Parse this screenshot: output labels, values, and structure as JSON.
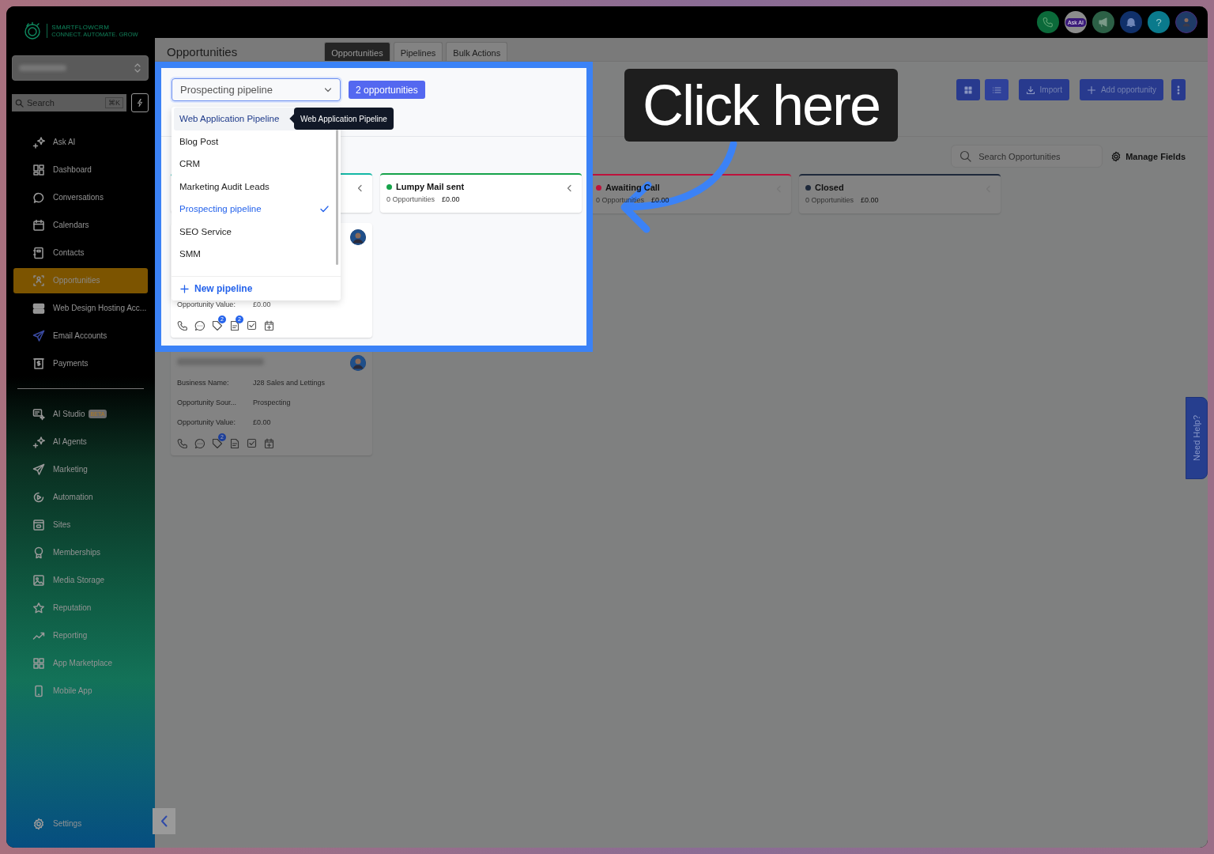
{
  "logo": {
    "name": "SMARTFLOWCRM",
    "tagline": "CONNECT. AUTOMATE. GROW"
  },
  "search": {
    "placeholder": "Search",
    "shortcut": "⌘K"
  },
  "sidebar": {
    "groups": [
      {
        "items": [
          {
            "label": "Ask AI",
            "selected": false
          },
          {
            "label": "Dashboard",
            "selected": false
          },
          {
            "label": "Conversations",
            "selected": false
          },
          {
            "label": "Calendars",
            "selected": false
          },
          {
            "label": "Contacts",
            "selected": false
          },
          {
            "label": "Opportunities",
            "selected": true
          },
          {
            "label": "Web Design Hosting Acc...",
            "selected": false
          },
          {
            "label": "Email Accounts",
            "selected": false
          },
          {
            "label": "Payments",
            "selected": false
          }
        ]
      },
      {
        "items": [
          {
            "label": "AI Studio",
            "selected": false,
            "badge": "BETA"
          },
          {
            "label": "AI Agents",
            "selected": false
          },
          {
            "label": "Marketing",
            "selected": false
          },
          {
            "label": "Automation",
            "selected": false
          },
          {
            "label": "Sites",
            "selected": false
          },
          {
            "label": "Memberships",
            "selected": false
          },
          {
            "label": "Media Storage",
            "selected": false
          },
          {
            "label": "Reputation",
            "selected": false
          },
          {
            "label": "Reporting",
            "selected": false
          },
          {
            "label": "App Marketplace",
            "selected": false
          },
          {
            "label": "Mobile App",
            "selected": false
          }
        ]
      }
    ],
    "footer_item": {
      "label": "Settings",
      "selected": false
    }
  },
  "topbar": {
    "ask_ai": "Ask AI",
    "help": "?"
  },
  "page_title": "Opportunities",
  "tabs": [
    {
      "label": "Opportunities",
      "selected": true
    },
    {
      "label": "Pipelines",
      "selected": false
    },
    {
      "label": "Bulk Actions",
      "selected": false
    }
  ],
  "toolbar": {
    "buttons": [
      {
        "label": "Import",
        "kind": "import"
      },
      {
        "label": "Add opportunity",
        "kind": "add"
      }
    ]
  },
  "search_opportunities": {
    "placeholder": "Search Opportunities"
  },
  "manage_fields": "Manage Fields",
  "stages": [
    {
      "color": "#14b8a6",
      "cards": [
        {
          "fields": [
            {
              "label": "Opportunity Value:",
              "value": "£0.00"
            }
          ],
          "tag_count": "2",
          "note_count": "2"
        },
        {
          "fields": [
            {
              "label": "Business Name:",
              "value": "J28 Sales and Lettings"
            },
            {
              "label": "Opportunity Sour...",
              "value": "Prospecting"
            },
            {
              "label": "Opportunity Value:",
              "value": "£0.00"
            }
          ],
          "tag_count": "2"
        }
      ]
    },
    {
      "name": "Lumpy Mail sent",
      "color": "#16a34a",
      "count": "0 Opportunities",
      "value": "£0.00"
    },
    {
      "name": "Awaiting Call",
      "color": "#be123c",
      "count": "0 Opportunities",
      "value": "£0.00"
    },
    {
      "name": "Closed",
      "color": "#1e293b",
      "count": "0 Opportunities",
      "value": "£0.00"
    }
  ],
  "spotlight": {
    "pipeline_select": {
      "value": "Prospecting pipeline"
    },
    "count": "2 opportunities",
    "dropdown": {
      "options": [
        {
          "label": "Web Application Pipeline",
          "selected": false,
          "highlighted": true
        },
        {
          "label": "Blog Post",
          "selected": false,
          "highlighted": false
        },
        {
          "label": "CRM",
          "selected": false,
          "highlighted": false
        },
        {
          "label": "Marketing Audit Leads",
          "selected": false,
          "highlighted": false
        },
        {
          "label": "Prospecting pipeline",
          "selected": true,
          "highlighted": false
        },
        {
          "label": "SEO Service",
          "selected": false,
          "highlighted": false
        },
        {
          "label": "SMM",
          "selected": false,
          "highlighted": false
        }
      ],
      "new_button": "New pipeline"
    },
    "tooltip": "Web Application Pipeline"
  },
  "callout": "Click here",
  "help_tab": "Need Help?"
}
